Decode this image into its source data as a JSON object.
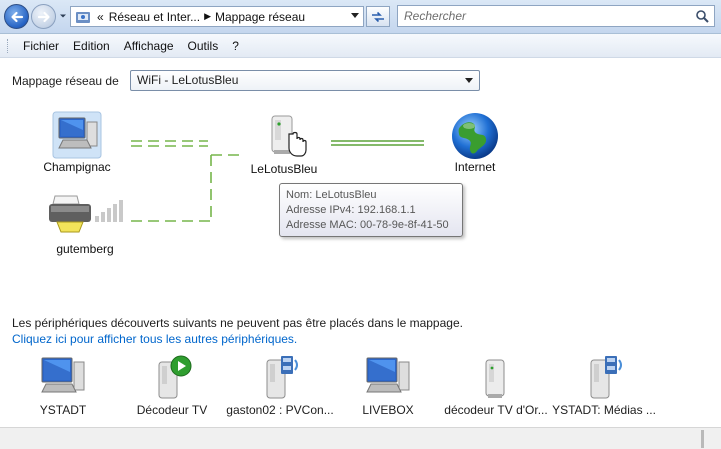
{
  "window": {
    "breadcrumbs": [
      "Réseau et Inter...",
      "Mappage réseau"
    ],
    "breadcrumb_prefix": "«",
    "search_placeholder": "Rechercher"
  },
  "menu": [
    "Fichier",
    "Edition",
    "Affichage",
    "Outils",
    "?"
  ],
  "map": {
    "label": "Mappage réseau de",
    "selected": "WiFi - LeLotusBleu"
  },
  "nodes": {
    "champignac": "Champignac",
    "gutemberg": "gutemberg",
    "router": "LeLotusBleu",
    "internet": "Internet"
  },
  "tooltip": {
    "name": "Nom: LeLotusBleu",
    "ipv4": "Adresse IPv4: 192.168.1.1",
    "mac": "Adresse MAC: 00-78-9e-8f-41-50"
  },
  "undiscovered": {
    "text": "Les périphériques découverts suivants ne peuvent pas être placés dans le mappage.",
    "link": "Cliquez ici pour afficher tous les autres périphériques."
  },
  "devices": [
    {
      "label": "YSTADT",
      "icon": "computer-icon"
    },
    {
      "label": "Décodeur TV",
      "icon": "media-player-icon"
    },
    {
      "label": "gaston02 : PVCon...",
      "icon": "media-server-icon"
    },
    {
      "label": "LIVEBOX",
      "icon": "computer-icon"
    },
    {
      "label": "décodeur TV d'Or...",
      "icon": "media-device-icon"
    },
    {
      "label": "YSTADT: Médias ...",
      "icon": "media-server-icon"
    }
  ],
  "colors": {
    "wireless_line": "#76b54b",
    "wired_line": "#5da33a",
    "link": "#0066cc",
    "chrome_bar": "#c4d6ee"
  }
}
